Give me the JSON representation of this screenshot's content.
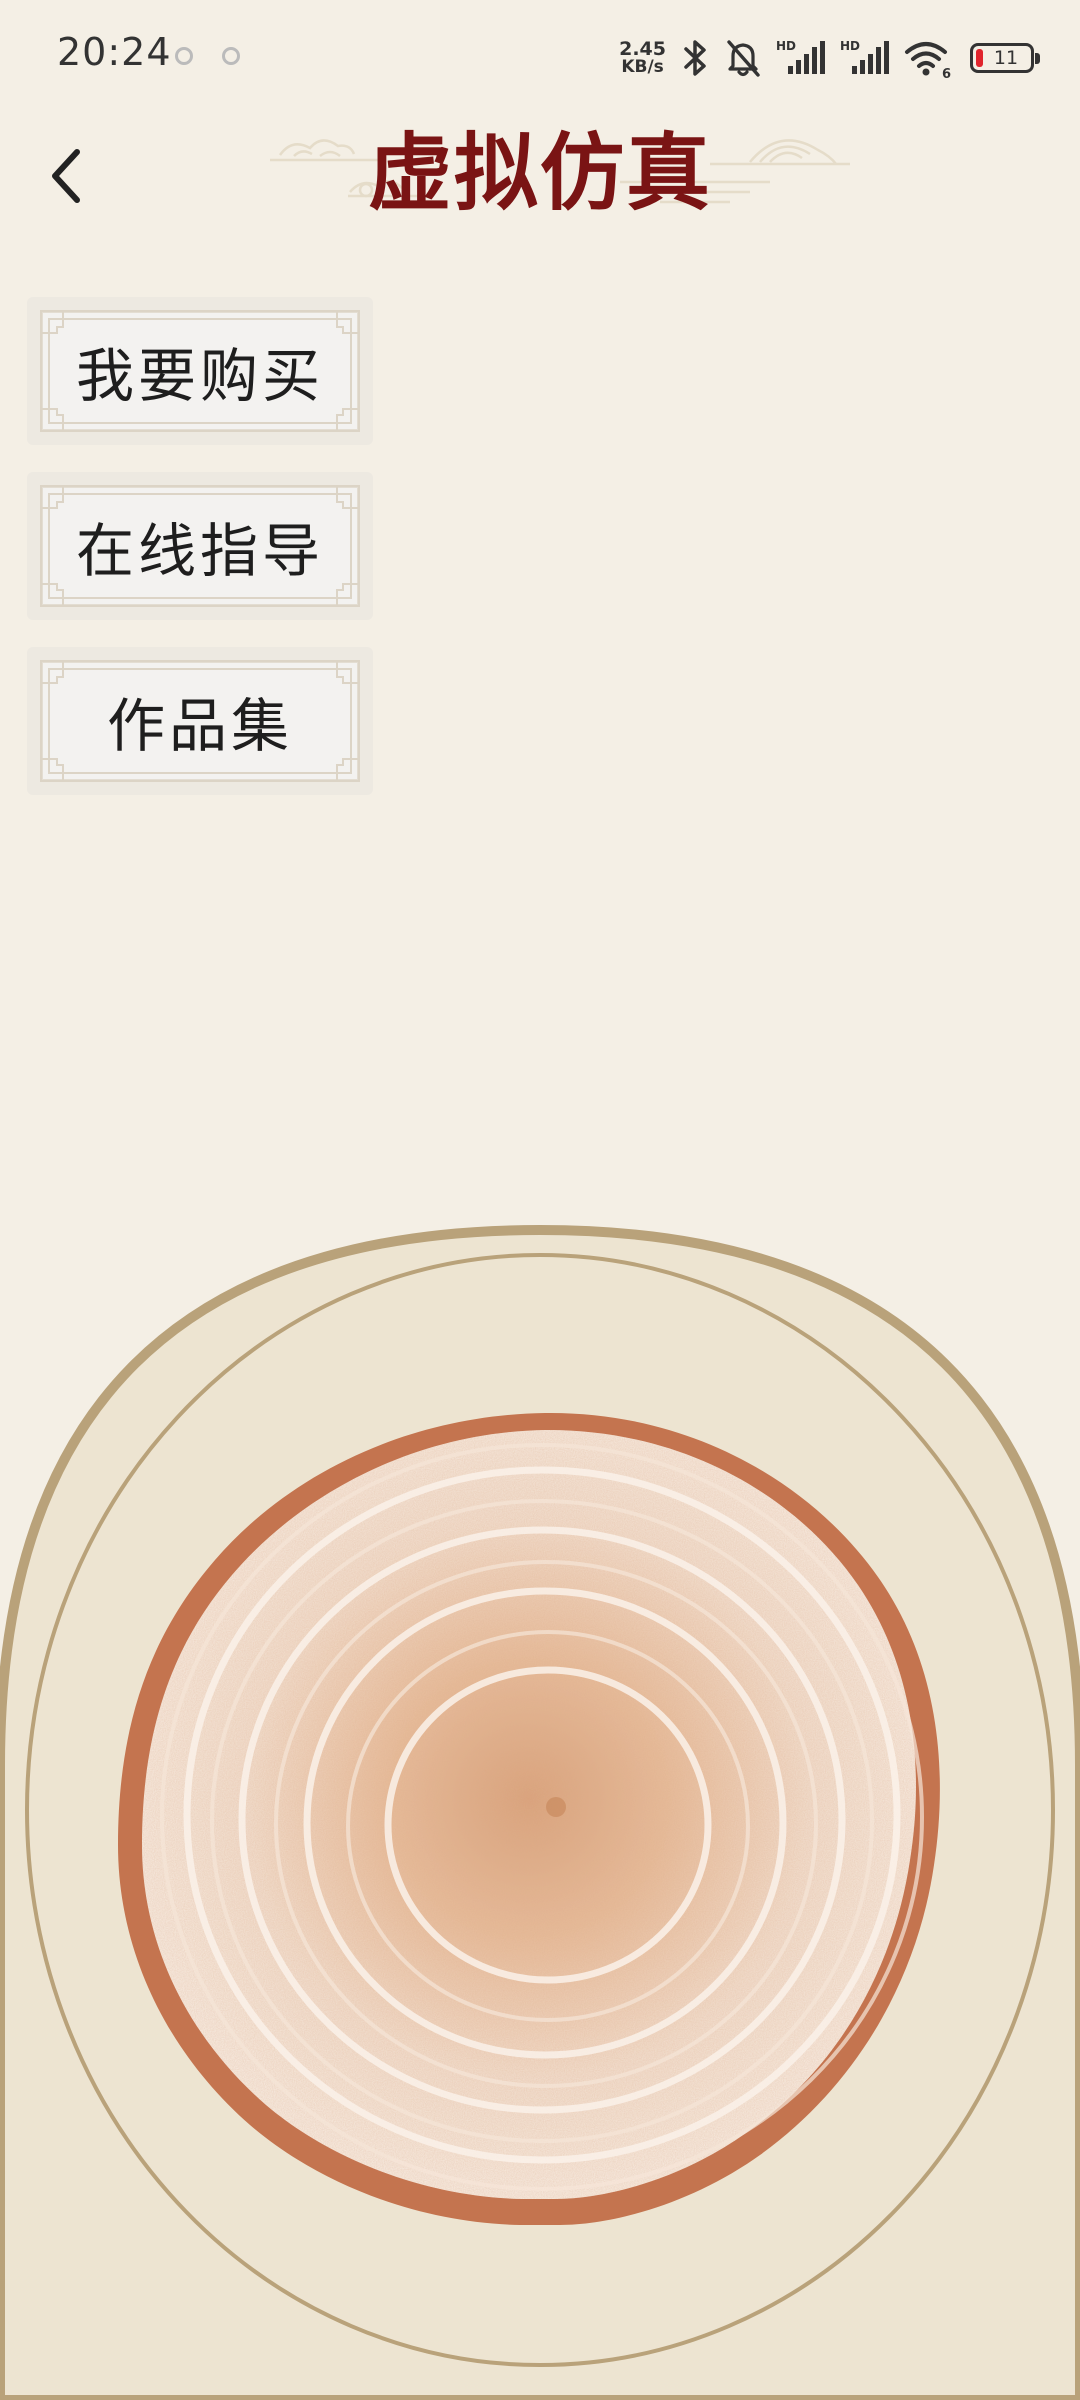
{
  "status_bar": {
    "time": "20:24",
    "net_speed_value": "2.45",
    "net_speed_unit": "KB/s",
    "sim1_label": "HD",
    "sim2_label": "HD",
    "wifi_label": "6",
    "battery_level": "11",
    "icons": [
      "bluetooth-icon",
      "silent-bell-icon",
      "signal-icon",
      "signal-icon",
      "wifi-icon",
      "battery-icon"
    ]
  },
  "header": {
    "back_icon": "chevron-left-icon",
    "title": "虚拟仿真"
  },
  "menu": {
    "items": [
      {
        "label": "我要购买"
      },
      {
        "label": "在线指导"
      },
      {
        "label": "作品集"
      }
    ]
  },
  "stage": {
    "image": "wood-slice",
    "frame_color": "#b9a27a",
    "background_color": "#ede4d1"
  },
  "colors": {
    "page_background": "#f4efe5",
    "title": "#7a1414",
    "button_background": "#f3f2f0",
    "battery_low": "#e0242c"
  }
}
